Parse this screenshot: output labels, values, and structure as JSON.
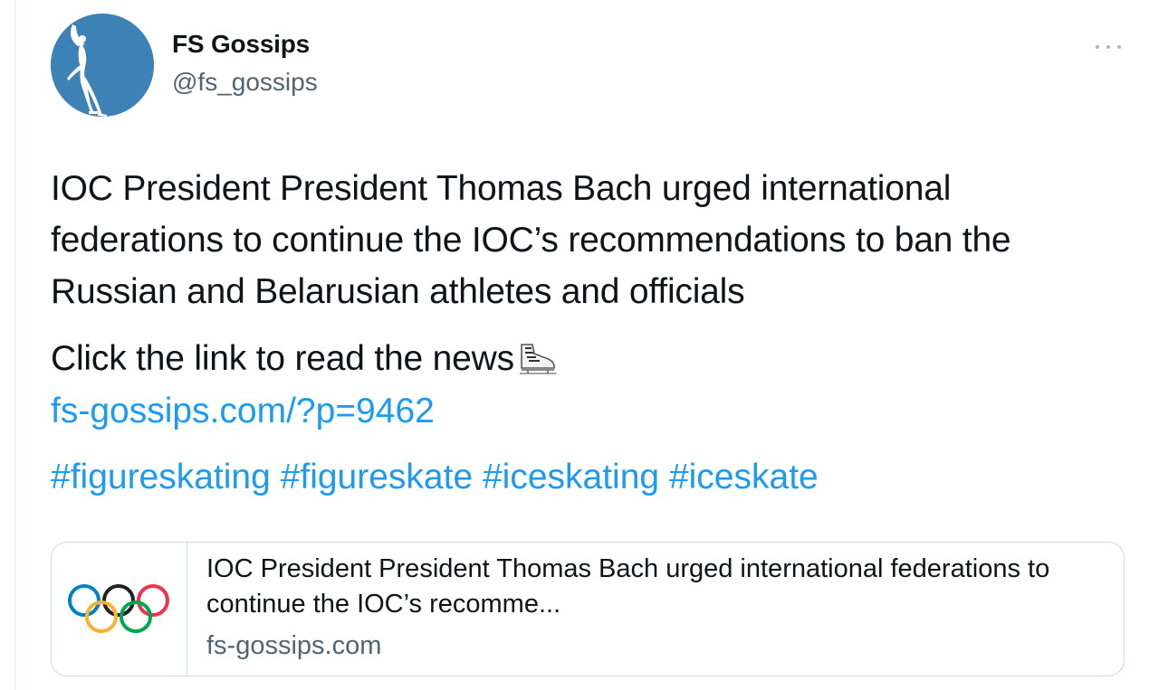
{
  "author": {
    "display_name": "FS Gossips",
    "handle": "@fs_gossips",
    "avatar_icon": "figure-skater-silhouette-icon",
    "avatar_color": "#3d82b7"
  },
  "tweet": {
    "text": "IOC President President Thomas Bach urged international federations to continue the IOC’s recommendations to ban the Russian and Belarusian athletes and officials",
    "cta": "Click the link to read the news",
    "cta_emoji": "ice-skate-icon",
    "link": "fs-gossips.com/?p=9462",
    "hashtags": [
      "#figureskating",
      "#figureskate",
      "#iceskating",
      "#iceskate"
    ]
  },
  "card": {
    "thumbnail_icon": "olympic-rings-icon",
    "title": "IOC President President Thomas Bach urged international federations to continue the IOC’s recomme...",
    "domain": "fs-gossips.com"
  },
  "colors": {
    "link": "#1d9bf0",
    "secondary_text": "#536471",
    "border": "#cfd9de"
  }
}
